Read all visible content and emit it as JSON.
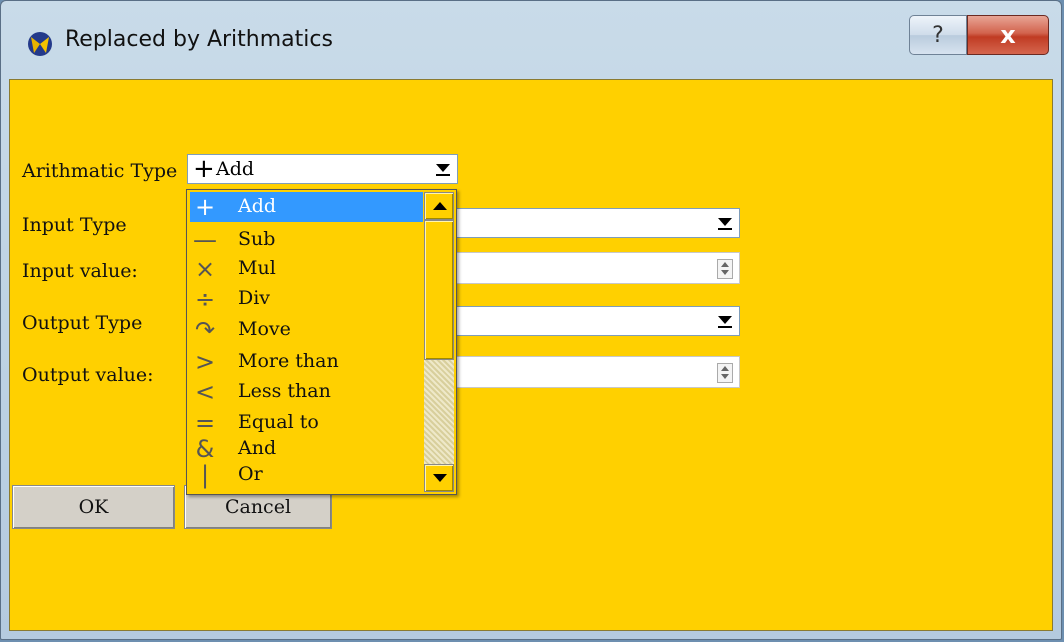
{
  "window": {
    "title": "Replaced by Arithmatics",
    "help_glyph": "?",
    "close_glyph": "x",
    "client_color": "#ffd000"
  },
  "form": {
    "arithmatic_type_label": "Arithmatic Type",
    "arithmatic_type_value": "Add",
    "arithmatic_type_symbol": "+",
    "input_type_label": "Input Type",
    "input_type_value": "",
    "input_value_label": "Input value:",
    "input_value_value": "",
    "output_type_label": "Output Type",
    "output_type_value": "",
    "output_value_label": "Output value:",
    "output_value_value": ""
  },
  "buttons": {
    "ok": "OK",
    "cancel": "Cancel"
  },
  "dropdown": {
    "selected_index": 0,
    "selected_color": "#3399ff",
    "items": [
      {
        "symbol": "+",
        "label": "Add"
      },
      {
        "symbol": "—",
        "label": "Sub"
      },
      {
        "symbol": "×",
        "label": "Mul"
      },
      {
        "symbol": "÷",
        "label": "Div"
      },
      {
        "symbol": "↷",
        "label": "Move"
      },
      {
        "symbol": ">",
        "label": "More than"
      },
      {
        "symbol": "<",
        "label": "Less than"
      },
      {
        "symbol": "=",
        "label": "Equal to"
      },
      {
        "symbol": "&",
        "label": "And"
      },
      {
        "symbol": "|",
        "label": "Or"
      }
    ]
  }
}
